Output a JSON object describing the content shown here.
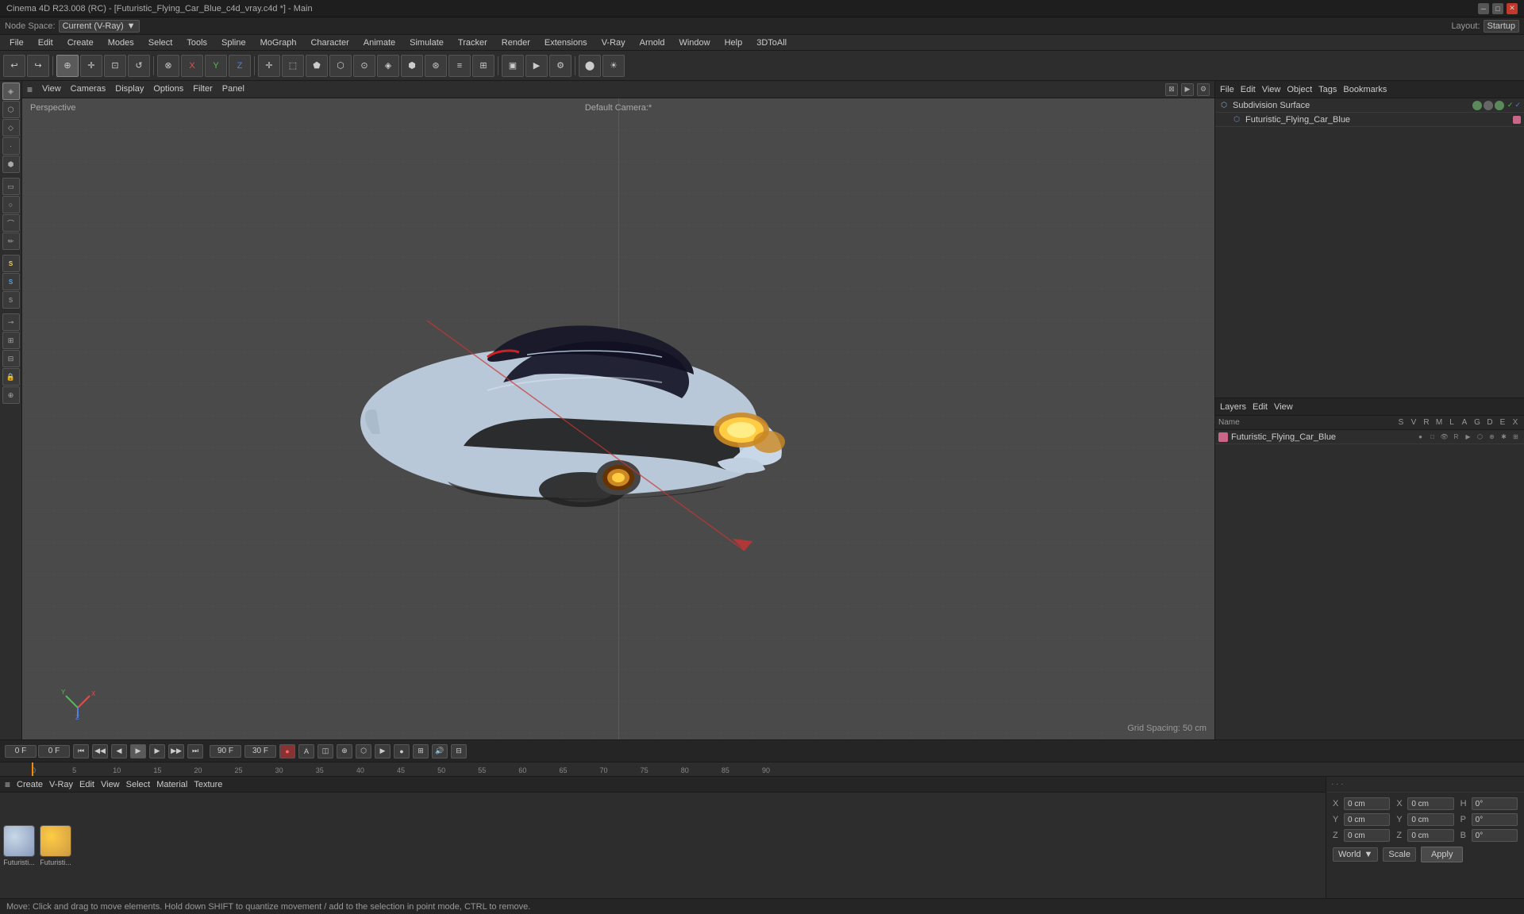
{
  "title": "Cinema 4D R23.008 (RC) - [Futuristic_Flying_Car_Blue_c4d_vray.c4d *] - Main",
  "window_controls": {
    "minimize": "─",
    "maximize": "□",
    "close": "✕"
  },
  "menu_bar": {
    "items": [
      "File",
      "Edit",
      "Create",
      "Modes",
      "Select",
      "Tools",
      "Spline",
      "MoGraph",
      "Character",
      "Animate",
      "Simulate",
      "Tracker",
      "Render",
      "Extensions",
      "V-Ray",
      "Arnold",
      "Window",
      "Help",
      "3DToAll"
    ]
  },
  "node_space": {
    "label": "Node Space:",
    "value": "Current (V-Ray)"
  },
  "layout": {
    "label": "Layout:",
    "value": "Startup"
  },
  "top_toolbar": {
    "undo_icon": "↩",
    "redo_icon": "↪",
    "icons": [
      "↺",
      "↻",
      "⟳",
      "⬚",
      "✛",
      "⊗",
      "⊕",
      "⊗",
      "⊚",
      "⊙",
      "⬛",
      "⬡",
      "⬢",
      "●",
      "◆",
      "⬤",
      "⊛",
      "≡",
      "⊞"
    ]
  },
  "viewport": {
    "perspective_label": "Perspective",
    "camera_label": "Default Camera:*",
    "grid_spacing": "Grid Spacing: 50 cm",
    "header_menus": [
      "≡",
      "View",
      "Cameras",
      "Display",
      "Options",
      "Filter",
      "Panel"
    ]
  },
  "object_manager": {
    "header_menus": [
      "File",
      "Edit",
      "View",
      "Object",
      "Tags",
      "Bookmarks"
    ],
    "objects": [
      {
        "name": "Subdivision Surface",
        "icon": "⬡",
        "icon_color": "#888",
        "check_green": true,
        "check_blue": true
      },
      {
        "name": "Futuristic_Flying_Car_Blue",
        "icon": "⬡",
        "icon_color": "#7788cc",
        "indented": true
      }
    ]
  },
  "layers": {
    "header_menus": [
      "Layers",
      "Edit",
      "View"
    ],
    "columns": [
      "Name",
      "S",
      "V",
      "R",
      "M",
      "L",
      "A",
      "G",
      "D",
      "E",
      "X"
    ],
    "items": [
      {
        "name": "Futuristic_Flying_Car_Blue",
        "color": "#cc6688"
      }
    ]
  },
  "timeline": {
    "header_menus": [
      "≡",
      "Create",
      "V-Ray",
      "Edit",
      "View",
      "Select",
      "Material",
      "Texture"
    ],
    "marks": [
      0,
      5,
      10,
      15,
      20,
      25,
      30,
      35,
      40,
      45,
      50,
      55,
      60,
      65,
      70,
      75,
      80,
      85,
      90
    ],
    "current_frame": "0 F",
    "start_frame": "0 F",
    "end_frame": "90 F",
    "fps_end": "90 F",
    "fps_display": "30 F",
    "controls": {
      "goto_start": "⏮",
      "prev_key": "◀◀",
      "prev_frame": "◀",
      "play": "▶",
      "next_frame": "▶",
      "next_key": "▶▶",
      "goto_end": "⏭",
      "record": "●",
      "auto": "A",
      "loop": "↺"
    }
  },
  "materials": {
    "header_menus": [
      "≡",
      "Create",
      "V-Ray",
      "Edit",
      "View",
      "Select",
      "Material",
      "Texture"
    ],
    "items": [
      {
        "name": "Futuristi...",
        "color": "#8899bb"
      },
      {
        "name": "Futuristi...",
        "color": "#cc9944"
      }
    ]
  },
  "coordinates": {
    "x_pos": "0 cm",
    "y_pos": "0 cm",
    "z_pos": "0 cm",
    "x_rot": "0°",
    "y_rot": "0°",
    "z_rot": "0°",
    "x_scale": "0 cm",
    "y_scale": "0 cm",
    "z_scale": "0 cm",
    "h_val": "0°",
    "p_val": "0°",
    "b_val": "0°",
    "world_dropdown": "World",
    "scale_dropdown": "Scale",
    "apply_btn": "Apply"
  },
  "status_bar": {
    "text": "Move: Click and drag to move elements. Hold down SHIFT to quantize movement / add to the selection in point mode, CTRL to remove."
  },
  "left_toolbar": {
    "icons": [
      "⊕",
      "▣",
      "◈",
      "⬡",
      "◉",
      "⬢",
      "⬟",
      "⊡",
      "▤",
      "⊸",
      "Ⓢ",
      "ⓢ",
      "Ⓢ",
      "⊛",
      "⬥",
      "⊞",
      "⊟"
    ]
  }
}
